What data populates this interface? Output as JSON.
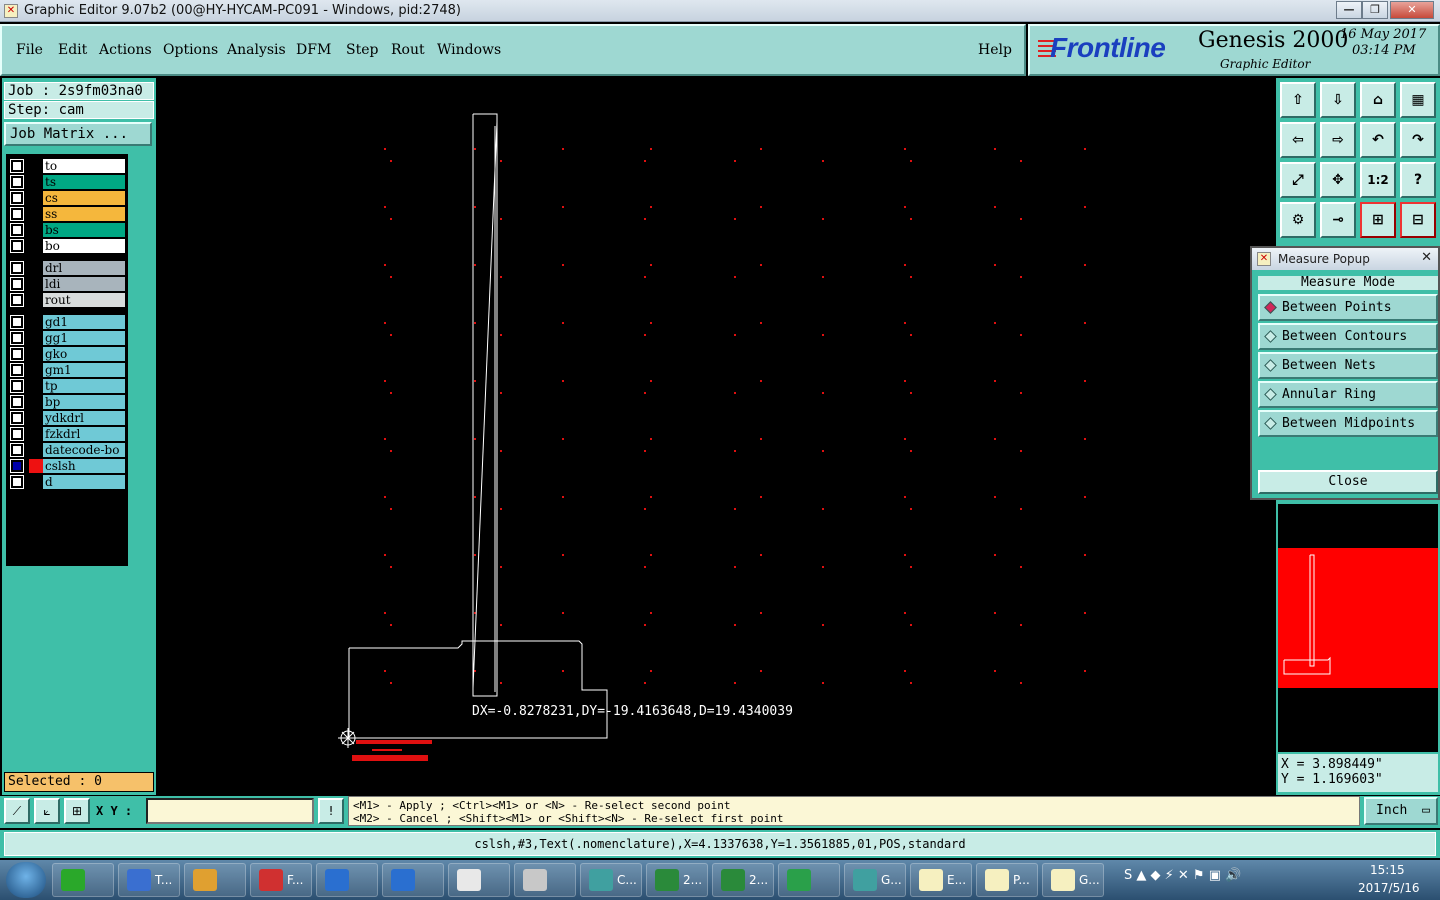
{
  "window": {
    "title": "Graphic Editor 9.07b2 (00@HY-HYCAM-PC091 - Windows, pid:2748)",
    "minimize": "—",
    "maximize": "❐",
    "close": "✕"
  },
  "menu": {
    "items": [
      "File",
      "Edit",
      "Actions",
      "Options",
      "Analysis",
      "DFM",
      "Step",
      "Rout",
      "Windows"
    ],
    "help": "Help"
  },
  "brand": {
    "logo": "Frontline",
    "product": "Genesis 2000",
    "subtitle": "Graphic Editor",
    "date": "16 May 2017",
    "time": "03:14 PM"
  },
  "job": {
    "job_line": "Job : 2s9fm03na0",
    "step_line": "Step: cam",
    "matrix_button": "Job Matrix ..."
  },
  "layers": [
    {
      "name": "to",
      "color": "#ffffff",
      "mark": "✎"
    },
    {
      "name": "ts",
      "color": "#00a884",
      "mark": ""
    },
    {
      "name": "cs",
      "color": "#f5b73c",
      "mark": "✎"
    },
    {
      "name": "ss",
      "color": "#f5b73c",
      "mark": "✎"
    },
    {
      "name": "bs",
      "color": "#00a884",
      "mark": ""
    },
    {
      "name": "bo",
      "color": "#ffffff",
      "mark": "✎"
    },
    {
      "name": "drl",
      "color": "#a8b4bc",
      "mark": ""
    },
    {
      "name": "ldi",
      "color": "#a8b4bc",
      "mark": ""
    },
    {
      "name": "rout",
      "color": "#d8dcdc",
      "mark": ""
    },
    {
      "name": "gd1",
      "color": "#6fc9d6",
      "mark": "✎"
    },
    {
      "name": "gg1",
      "color": "#6fc9d6",
      "mark": ""
    },
    {
      "name": "gko",
      "color": "#6fc9d6",
      "mark": ""
    },
    {
      "name": "gm1",
      "color": "#6fc9d6",
      "mark": ""
    },
    {
      "name": "tp",
      "color": "#6fc9d6",
      "mark": ""
    },
    {
      "name": "bp",
      "color": "#6fc9d6",
      "mark": ""
    },
    {
      "name": "ydkdrl",
      "color": "#6fc9d6",
      "mark": ""
    },
    {
      "name": "fzkdrl",
      "color": "#6fc9d6",
      "mark": ""
    },
    {
      "name": "datecode-bo",
      "color": "#6fc9d6",
      "mark": ""
    },
    {
      "name": "cslsh",
      "color": "#6fc9d6",
      "mark": "▪",
      "active": true
    },
    {
      "name": "d",
      "color": "#6fc9d6",
      "mark": ""
    }
  ],
  "selected": "Selected : 0",
  "measure_result": "DX=-0.8278231,DY=-19.4163648,D=19.4340039",
  "measure_popup": {
    "title": "Measure Popup",
    "close_x": "✕",
    "mode_header": "Measure Mode",
    "options": [
      "Between Points",
      "Between Contours",
      "Between Nets",
      "Annular Ring",
      "Between Midpoints"
    ],
    "active_option": 0,
    "close_button": "Close"
  },
  "toolbar_icons": [
    "layer-up-icon",
    "layer-down-icon",
    "home-icon",
    "panel-icon",
    "arrow-left-icon",
    "arrow-right-icon",
    "undo-icon",
    "redo-icon",
    "zoom-fit-icon",
    "zoom-center-icon",
    "scale-icon",
    "help-icon",
    "settings-icon",
    "probe-icon",
    "net-icon",
    "net-select-icon"
  ],
  "toolbar_glyphs": [
    "⇧",
    "⇩",
    "⌂",
    "▦",
    "⇦",
    "⇨",
    "↶",
    "↷",
    "⤢",
    "✥",
    "1:2",
    "?",
    "⚙",
    "⊸",
    "⊞",
    "⊟"
  ],
  "coords": {
    "x": "X = 3.898449\"",
    "y": "Y = 1.169603\""
  },
  "bottom": {
    "xy_label": "X Y :",
    "xy_value": "",
    "alert": "!",
    "hint_line1": "<M1> - Apply  ; <Ctrl><M1> or <N> - Re-select second point",
    "hint_line2": "<M2> - Cancel ; <Shift><M1> or <Shift><N> - Re-select first point",
    "unit": "Inch"
  },
  "status": "cslsh,#3,Text(.nomenclature),X=4.1337638,Y=1.3561885,01,POS,standard",
  "taskbar": {
    "items": [
      {
        "label": "",
        "color": "#2aa82a"
      },
      {
        "label": "T...",
        "color": "#3a6fd0"
      },
      {
        "label": "",
        "color": "#e0a030"
      },
      {
        "label": "F...",
        "color": "#d03030"
      },
      {
        "label": "",
        "color": "#2a6fd0"
      },
      {
        "label": "",
        "color": "#2a6fd0"
      },
      {
        "label": "",
        "color": "#e8e8e8"
      },
      {
        "label": "",
        "color": "#c8c8c8"
      },
      {
        "label": "C...",
        "color": "#40a0a0"
      },
      {
        "label": "2...",
        "color": "#2a8a3a"
      },
      {
        "label": "2...",
        "color": "#2a8a3a"
      },
      {
        "label": "",
        "color": "#2aa04a"
      },
      {
        "label": "G...",
        "color": "#40a0a0"
      },
      {
        "label": "E...",
        "color": "#f6f0c0"
      },
      {
        "label": "P...",
        "color": "#f6f0c0"
      },
      {
        "label": "G...",
        "color": "#f6f0c0"
      }
    ],
    "time": "15:15",
    "date": "2017/5/16"
  }
}
